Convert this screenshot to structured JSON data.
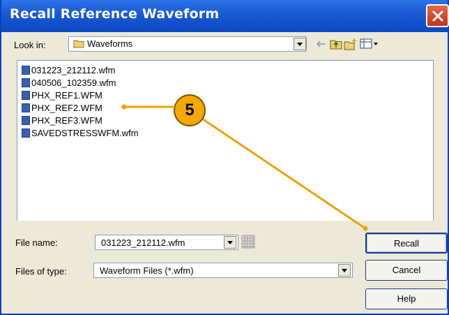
{
  "dialog": {
    "title": "Recall Reference Waveform"
  },
  "look_in": {
    "label": "Look in:",
    "value": "Waveforms"
  },
  "files": [
    "031223_212112.wfm",
    "040506_102359.wfm",
    "PHX_REF1.WFM",
    "PHX_REF2.WFM",
    "PHX_REF3.WFM",
    "SAVEDSTRESSWFM.wfm"
  ],
  "file_name": {
    "label": "File name:",
    "value": "031223_212112.wfm"
  },
  "file_type": {
    "label": "Files of type:",
    "value": "Waveform Files (*.wfm)"
  },
  "buttons": {
    "recall": "Recall",
    "cancel": "Cancel",
    "help": "Help"
  },
  "callout": {
    "number": "5"
  },
  "colors": {
    "titlebar": "#0c48c2",
    "callout": "#f5a800",
    "callout_line": "#f0a000"
  },
  "icons": [
    "folder-icon",
    "back-arrow-icon",
    "up-folder-icon",
    "new-folder-icon",
    "view-menu-icon",
    "file-icon",
    "grid-icon",
    "close-icon"
  ]
}
